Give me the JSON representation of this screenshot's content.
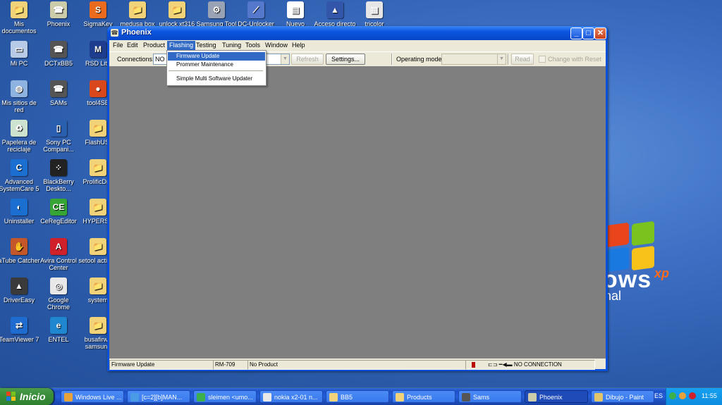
{
  "desktop": {
    "icons": [
      {
        "label": "Mis documentos",
        "color": "#f3d37a",
        "glyph": "📁",
        "icon": "my-documents-icon"
      },
      {
        "label": "Phoenix",
        "color": "#ccccaa",
        "glyph": "☎",
        "icon": "phoenix-icon"
      },
      {
        "label": "SigmaKey",
        "color": "#ea6b1d",
        "glyph": "S",
        "icon": "sigmakey-icon"
      },
      {
        "label": "medusa box",
        "color": "#f3d37a",
        "glyph": "📁",
        "icon": "folder-icon"
      },
      {
        "label": "unlock xt316",
        "color": "#f3d37a",
        "glyph": "📁",
        "icon": "folder-icon"
      },
      {
        "label": "Samsung Tool",
        "color": "#9aa3b5",
        "glyph": "⚙",
        "icon": "gear-icon"
      },
      {
        "label": "DC-Unlocker",
        "color": "#5577cc",
        "glyph": "⟋",
        "icon": "dc-unlocker-icon"
      },
      {
        "label": "Nuevo",
        "color": "#ffffff",
        "glyph": "▤",
        "icon": "document-icon"
      },
      {
        "label": "Acceso directo",
        "color": "#3355aa",
        "glyph": "▲",
        "icon": "shortcut-icon"
      },
      {
        "label": "tricolor",
        "color": "#e6e6e6",
        "glyph": "▦",
        "icon": "image-icon"
      },
      {
        "label": "Mi PC",
        "color": "#b7cbe7",
        "glyph": "▭",
        "icon": "my-computer-icon"
      },
      {
        "label": "DCTxBB5",
        "color": "#555555",
        "glyph": "☎",
        "icon": "phone-tool-icon"
      },
      {
        "label": "RSD Lite",
        "color": "#1f3d8f",
        "glyph": "M",
        "icon": "rsd-lite-icon"
      },
      {
        "label": "Mis sitios de red",
        "color": "#8fb3e0",
        "glyph": "◍",
        "icon": "network-icon"
      },
      {
        "label": "SAMs",
        "color": "#555555",
        "glyph": "☎",
        "icon": "phone-tool-icon"
      },
      {
        "label": "tool4SE",
        "color": "#d9471c",
        "glyph": "●",
        "icon": "tool4se-icon"
      },
      {
        "label": "Papelera de reciclaje",
        "color": "#cde3d0",
        "glyph": "♻",
        "icon": "recycle-bin-icon"
      },
      {
        "label": "Sony PC Compani...",
        "color": "#2a5fb0",
        "glyph": "▯",
        "icon": "sony-pc-icon"
      },
      {
        "label": "FlashUSI",
        "color": "#f3d37a",
        "glyph": "📁",
        "icon": "folder-icon"
      },
      {
        "label": "Advanced SystemCare 5",
        "color": "#1b6fd0",
        "glyph": "C",
        "icon": "systemcare-icon"
      },
      {
        "label": "BlackBerry Deskto...",
        "color": "#222222",
        "glyph": "⁘",
        "icon": "blackberry-icon"
      },
      {
        "label": "ProlificDriv",
        "color": "#f3d37a",
        "glyph": "📁",
        "icon": "folder-icon"
      },
      {
        "label": "Uninstaller",
        "color": "#1b6fd0",
        "glyph": "◐",
        "icon": "uninstaller-icon"
      },
      {
        "label": "CeRegEditor",
        "color": "#36a536",
        "glyph": "CE",
        "icon": "ceregeditor-icon"
      },
      {
        "label": "HYPERSN",
        "color": "#f3d37a",
        "glyph": "📁",
        "icon": "folder-icon"
      },
      {
        "label": "aTube Catcher",
        "color": "#c4572a",
        "glyph": "✋",
        "icon": "atube-catcher-icon"
      },
      {
        "label": "Avira Control Center",
        "color": "#d0202a",
        "glyph": "A",
        "icon": "avira-icon"
      },
      {
        "label": "setool activad",
        "color": "#f3d37a",
        "glyph": "📁",
        "icon": "folder-icon"
      },
      {
        "label": "DriverEasy",
        "color": "#3a3a3a",
        "glyph": "▲",
        "icon": "drivereasy-icon"
      },
      {
        "label": "Google Chrome",
        "color": "#e8e8e8",
        "glyph": "◎",
        "icon": "chrome-icon"
      },
      {
        "label": "system",
        "color": "#f3d37a",
        "glyph": "📁",
        "icon": "folder-icon"
      },
      {
        "label": "TeamViewer 7",
        "color": "#1f6cd0",
        "glyph": "⇄",
        "icon": "teamviewer-icon"
      },
      {
        "label": "ENTEL",
        "color": "#1f86d0",
        "glyph": "e",
        "icon": "entel-icon"
      },
      {
        "label": "busafirwa samsung",
        "color": "#f3d37a",
        "glyph": "📁",
        "icon": "folder-icon"
      }
    ],
    "xp": {
      "word": "ows",
      "sup": "xp",
      "sub": "nal"
    }
  },
  "window": {
    "title": "Phoenix",
    "icon_glyph": "☎",
    "controls": {
      "minimize": "_",
      "maximize": "□",
      "close": "✕"
    },
    "menu": [
      "File",
      "Edit",
      "Product",
      "Flashing",
      "Testing",
      "Tuning",
      "Tools",
      "Window",
      "Help"
    ],
    "toolbar": {
      "connections_label": "Connections:",
      "connections_value": "NO C",
      "refresh_label": "Refresh",
      "settings_label": "Settings...",
      "operating_mode_label": "Operating mode:",
      "operating_mode_value": "",
      "read_label": "Read",
      "change_with_reset_label": "Change with Reset"
    },
    "flashing_menu": [
      "Firmware Update",
      "Prommer Maintenance",
      "Simple Multi Software Updater"
    ],
    "status": {
      "mode": "Firmware Update",
      "product_code": "RM-709",
      "product": "No Product",
      "connection": "NO CONNECTION"
    }
  },
  "taskbar": {
    "start_label": "Inicio",
    "tasks": [
      {
        "label": "Windows Live ...",
        "color": "#e8a23a"
      },
      {
        "label": "[c=2][b]MAN...",
        "color": "#4a9be6"
      },
      {
        "label": "sleimen <umo...",
        "color": "#3cb04a"
      },
      {
        "label": "nokia x2-01 n...",
        "color": "#e8e8e8"
      },
      {
        "label": "BB5",
        "color": "#f3d37a"
      },
      {
        "label": "Products",
        "color": "#f3d37a"
      },
      {
        "label": "Sams",
        "color": "#555555"
      },
      {
        "label": "Phoenix",
        "color": "#ccccaa",
        "active": true
      },
      {
        "label": "Dibujo - Paint",
        "color": "#e2c469"
      }
    ],
    "language": "ES",
    "clock": "11:55"
  },
  "colors": {
    "accent": "#316ac5",
    "titlebar": "#0a55e0",
    "workarea": "#7f7f7f",
    "taskbar": "#245edb",
    "start": "#3a8e3a"
  }
}
